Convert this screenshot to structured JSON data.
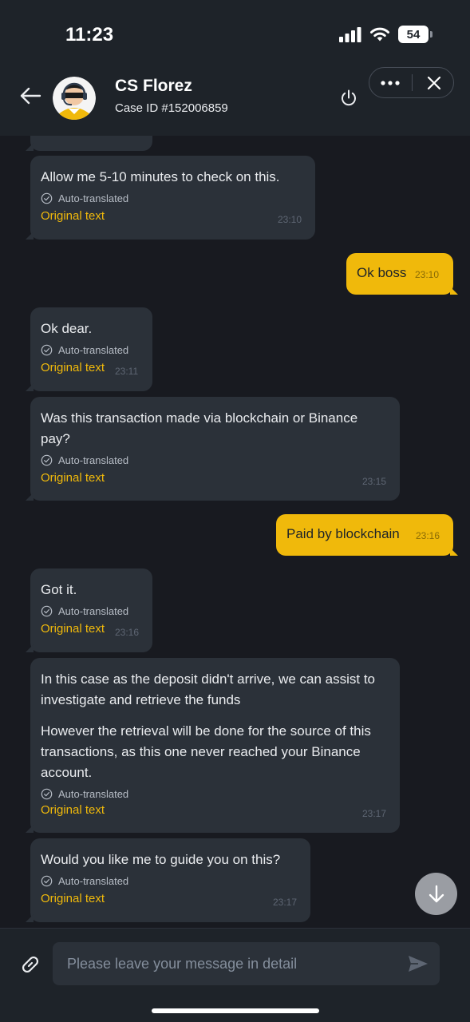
{
  "status_bar": {
    "time": "11:23",
    "battery": "54"
  },
  "header": {
    "agent_name": "CS Florez",
    "case_id": "Case ID #152006859"
  },
  "labels": {
    "auto_translated": "Auto-translated",
    "original_text": "Original text"
  },
  "messages": [
    {
      "from": "agent",
      "text": "Allow me 5-10 minutes to check on this.",
      "time": "23:10"
    },
    {
      "from": "user",
      "text": "Ok boss",
      "time": "23:10"
    },
    {
      "from": "agent",
      "text": "Ok dear.",
      "time": "23:11"
    },
    {
      "from": "agent",
      "text": "Was this transaction made via blockchain or Binance pay?",
      "time": "23:15"
    },
    {
      "from": "user",
      "text": "Paid by blockchain",
      "time": "23:16"
    },
    {
      "from": "agent",
      "text": "Got it.",
      "time": "23:16"
    },
    {
      "from": "agent",
      "text": "In this case as the deposit didn't arrive, we can assist to investigate and retrieve the funds",
      "text2": "However the retrieval will be done for the source of this transactions, as this one never reached your Binance account.",
      "time": "23:17"
    },
    {
      "from": "agent",
      "text": "Would you like me to guide you on this?",
      "time": "23:17"
    }
  ],
  "composer": {
    "placeholder": "Please leave your message in detail"
  },
  "colors": {
    "accent": "#f0b90b",
    "bubble_agent": "#2b3139",
    "background": "#181a20"
  },
  "icons": [
    "back-arrow-icon",
    "avatar-icon",
    "power-icon",
    "more-icon",
    "close-icon",
    "check-circle-icon",
    "scroll-down-icon",
    "link-icon",
    "send-icon"
  ]
}
